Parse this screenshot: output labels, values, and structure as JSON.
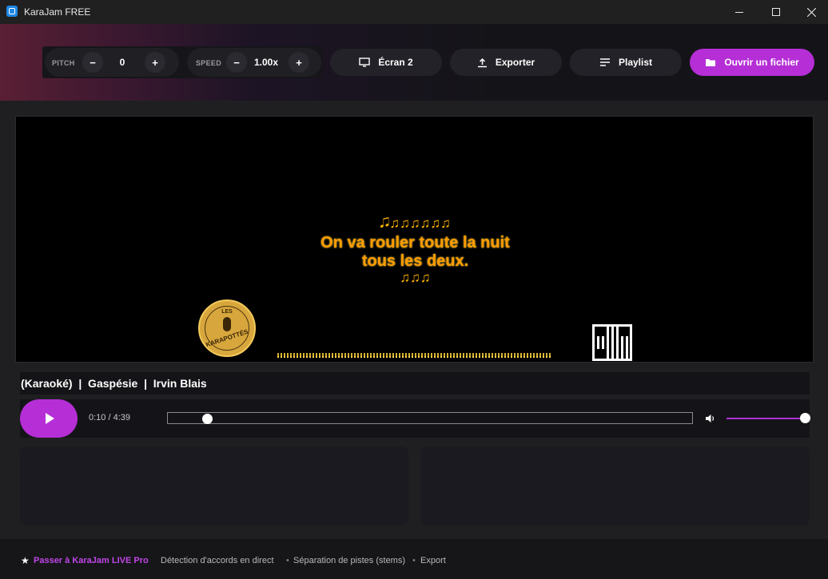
{
  "window": {
    "title": "KaraJam FREE"
  },
  "toolbar": {
    "pitch": {
      "label": "PITCH",
      "minus": "−",
      "value": "0",
      "plus": "+"
    },
    "speed": {
      "label": "SPEED",
      "minus": "−",
      "value": "1.00x",
      "plus": "+"
    },
    "screen_label": "Écran 2",
    "export_label": "Exporter",
    "playlist_label": "Playlist",
    "open_file_label": "Ouvrir un fichier"
  },
  "video": {
    "notes_top": "🎜♫♫♫♫♫♫",
    "lyric_line_1": "On va rouler toute la nuit",
    "lyric_line_2": "tous les deux.",
    "notes_bottom": "♫♫♫",
    "logo_text_top": "LES",
    "logo_text_bottom": "KARAPOTTÉS"
  },
  "song": {
    "info": "(Karaoké)  |  Gaspésie  |  Irvin Blais"
  },
  "player": {
    "time": "0:10 / 4:39",
    "progress_fraction": 0.036,
    "volume_fraction": 1.0
  },
  "footer": {
    "star": "★",
    "pro_label": "Passer à KaraJam LIVE Pro",
    "feature_1": "Détection d'accords en direct",
    "feature_2": "Séparation de pistes (stems)",
    "feature_3": "Export",
    "separator": "•"
  },
  "colors": {
    "accent": "#b52ed6",
    "lyric": "#ff9c00"
  }
}
